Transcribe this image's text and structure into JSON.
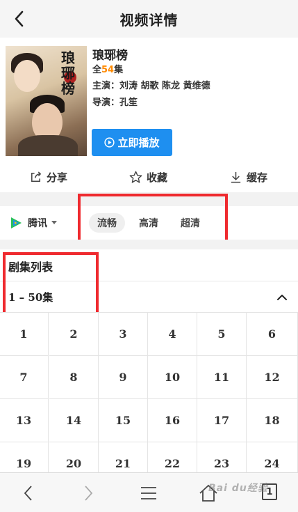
{
  "header": {
    "title": "视频详情"
  },
  "video": {
    "poster_title": "琅琊榜",
    "name": "琅琊榜",
    "episodes_prefix": "全",
    "episodes_count": "54",
    "episodes_suffix": "集",
    "cast": "主演：刘涛 胡歌 陈龙 黄维德",
    "director": "导演：孔笙",
    "play_label": "立即播放"
  },
  "actions": {
    "share": "分享",
    "favorite": "收藏",
    "download": "缓存"
  },
  "source": {
    "name": "腾讯"
  },
  "quality": [
    "流畅",
    "高清",
    "超清"
  ],
  "episode_list": {
    "title": "剧集列表",
    "range": "1 – 50集",
    "visible_episodes": [
      "1",
      "2",
      "3",
      "4",
      "5",
      "6",
      "7",
      "8",
      "9",
      "10",
      "11",
      "12",
      "13",
      "14",
      "15",
      "16",
      "17",
      "18",
      "19",
      "20",
      "21",
      "22",
      "23",
      "24"
    ]
  },
  "bottom_bar": {
    "tab_count": "1"
  },
  "watermark": "Bai du经验",
  "colors": {
    "accent": "#1e8ff0",
    "highlight": "#ff8a00",
    "annotation": "#ef2a2f"
  }
}
